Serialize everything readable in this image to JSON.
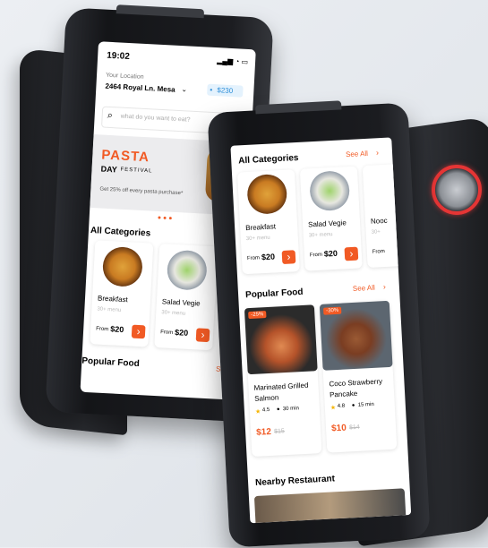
{
  "status": {
    "time": "19:02",
    "signal_icons": "signal-wifi-battery"
  },
  "location": {
    "label": "Your Location",
    "address": "2464 Royal Ln. Mesa",
    "wallet": "$230"
  },
  "search": {
    "placeholder": "what do you want to eat?"
  },
  "banner": {
    "title": "PASTA",
    "subtitle_a": "DAY",
    "subtitle_b": "FESTIVAL",
    "note": "Get 25% off every pasta purchase*"
  },
  "sections": {
    "categories": "All Categories",
    "see_all": "See All",
    "see_all_short": "See",
    "popular": "Popular Food",
    "nearby": "Nearby Restaurant"
  },
  "categories": [
    {
      "name": "Breakfast",
      "count": "30+ menu",
      "from": "From",
      "price": "$20"
    },
    {
      "name": "Salad Vegie",
      "count": "30+ menu",
      "from": "From",
      "price": "$20"
    },
    {
      "name": "Nooc",
      "count": "30+",
      "from": "From",
      "price": ""
    }
  ],
  "foods": [
    {
      "discount": "-25%",
      "name": "Marinated Grilled Salmon",
      "rating": "4.5",
      "time": "30 min",
      "price": "$12",
      "old_price": "$15"
    },
    {
      "discount": "-30%",
      "name": "Coco Strawberry Pancake",
      "rating": "4.8",
      "time": "15 min",
      "price": "$10",
      "old_price": "$14"
    }
  ],
  "colors": {
    "accent": "#f15a24",
    "knob_ring": "#e53535",
    "wallet": "#2f8fd8"
  }
}
